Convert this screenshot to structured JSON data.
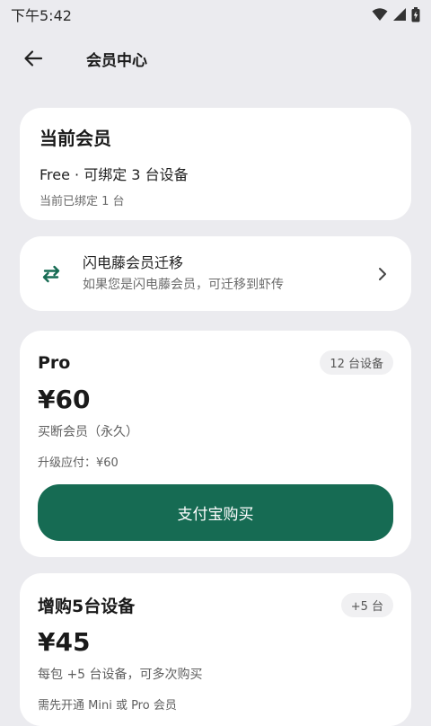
{
  "status_bar": {
    "time": "下午5:42"
  },
  "header": {
    "title": "会员中心"
  },
  "current_membership": {
    "title": "当前会员",
    "plan": "Free · 可绑定 3 台设备",
    "bound": "当前已绑定 1 台"
  },
  "migration": {
    "title": "闪电藤会员迁移",
    "description": "如果您是闪电藤会员，可迁移到虾传"
  },
  "plans": [
    {
      "name": "Pro",
      "badge": "12 台设备",
      "price": "¥60",
      "description": "买断会员（永久）",
      "note": "升级应付：¥60",
      "button_label": "支付宝购买"
    },
    {
      "name": "增购5台设备",
      "badge": "+5 台",
      "price": "¥45",
      "description": "每包 +5 台设备，可多次购买",
      "note": "需先开通 Mini 或 Pro 会员"
    }
  ],
  "colors": {
    "background": "#ebebef",
    "primary": "#166b53",
    "card": "#ffffff"
  },
  "icons": {
    "back": "arrow-left-icon",
    "migrate": "swap-arrows-icon",
    "chevron": "chevron-right-icon",
    "wifi": "wifi-icon",
    "signal": "signal-icon",
    "battery": "battery-icon"
  }
}
